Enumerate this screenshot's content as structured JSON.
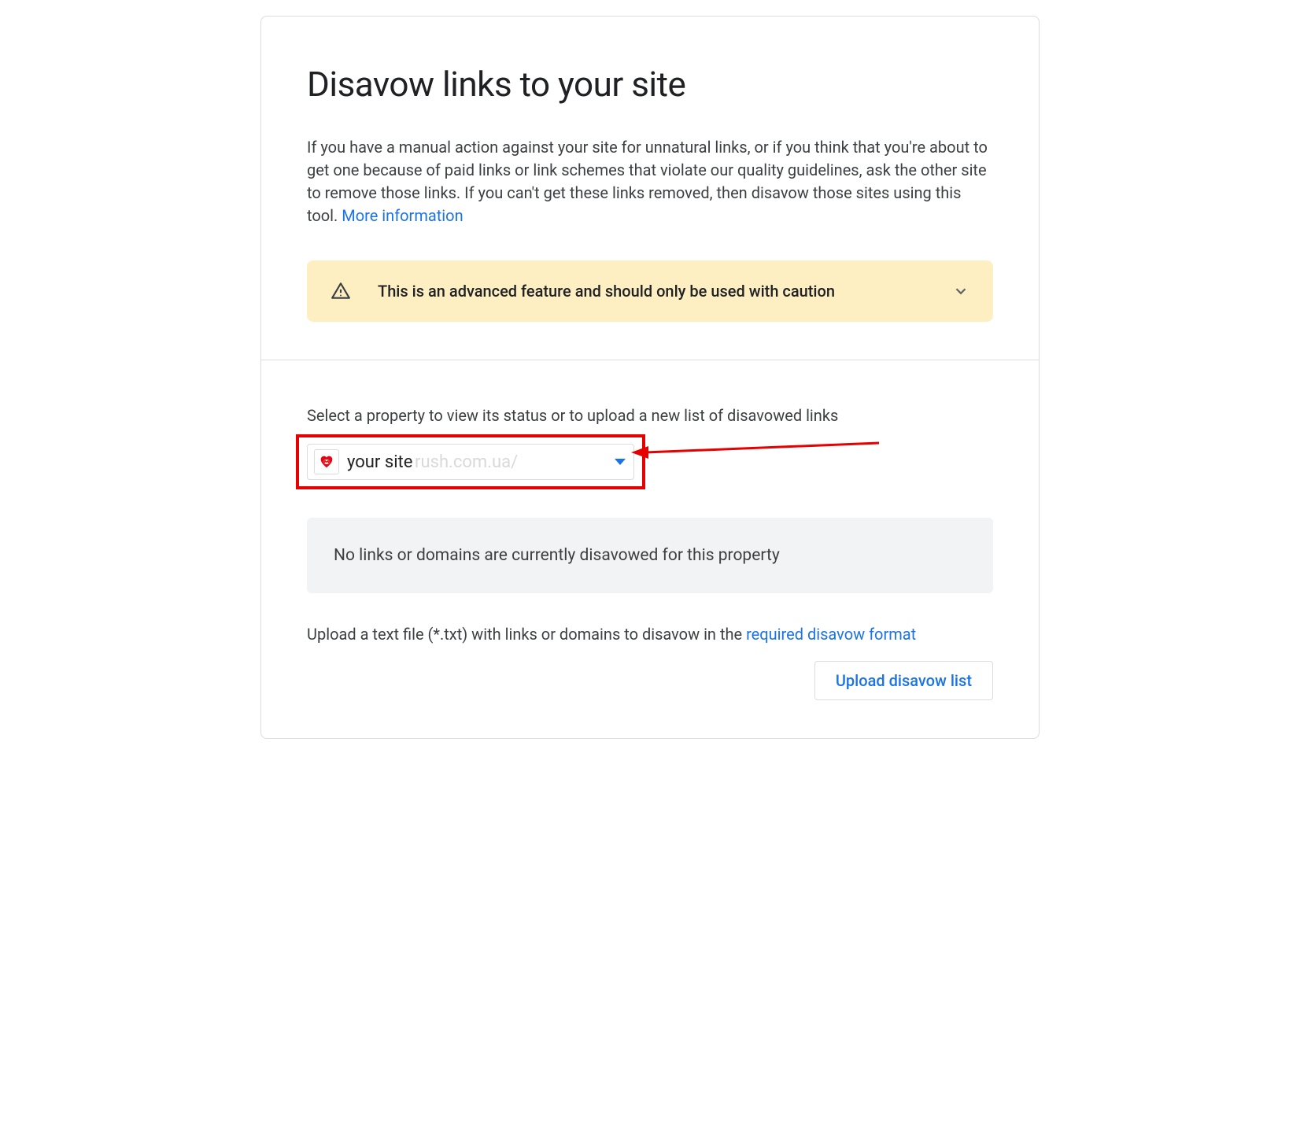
{
  "header": {
    "title": "Disavow links to your site",
    "description_prefix": "If you have a manual action against your site for unnatural links, or if you think that you're about to get one because of paid links or link schemes that violate our quality guidelines, ask the other site to remove those links. If you can't get these links removed, then disavow those sites using this tool. ",
    "more_info_label": "More information"
  },
  "warning": {
    "text": "This is an advanced feature and should only be used with caution"
  },
  "property": {
    "select_label": "Select a property to view its status or to upload a new list of disavowed links",
    "selected_value": "your site",
    "ghost_suffix": "rush.com.ua/"
  },
  "status": {
    "empty_message": "No links or domains are currently disavowed for this property"
  },
  "upload": {
    "instruction_prefix": "Upload a text file (*.txt) with links or domains to disavow in the ",
    "format_link_label": "required disavow format",
    "button_label": "Upload disavow list"
  }
}
